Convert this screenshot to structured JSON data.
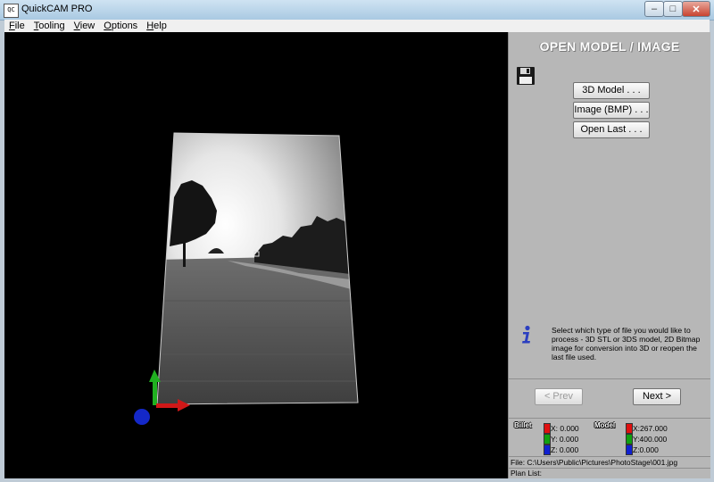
{
  "window": {
    "title": "QuickCAM PRO",
    "icon_text": "QC",
    "controls": {
      "minimize": "–",
      "maximize": "□",
      "close": "✕"
    }
  },
  "menu": {
    "items": [
      {
        "underlined": "F",
        "rest": "ile"
      },
      {
        "underlined": "T",
        "rest": "ooling"
      },
      {
        "underlined": "V",
        "rest": "iew"
      },
      {
        "underlined": "O",
        "rest": "ptions"
      },
      {
        "underlined": "H",
        "rest": "elp"
      }
    ]
  },
  "panel": {
    "title": "OPEN MODEL / IMAGE",
    "icon": "floppy-disk-icon",
    "buttons": {
      "model_3d": "3D Model . . .",
      "image_bmp": "Image (BMP) . . .",
      "open_last": "Open Last . . ."
    },
    "info_icon": "info-icon",
    "info_text": "Select which type of file you would like to process - 3D STL or 3DS model, 2D Bitmap image for conversion into 3D or reopen the last file used.",
    "prev_label": "< Prev",
    "next_label": "Next >"
  },
  "coords": {
    "billet_label": "Billet",
    "model_label": "Model",
    "billet": {
      "x": "X: 0.000",
      "y": "Y: 0.000",
      "z": "Z: 0.000"
    },
    "model": {
      "x": "X:267.000",
      "y": "Y:400.000",
      "z": "Z:0.000"
    },
    "colors": {
      "x": "#e01010",
      "y": "#10a010",
      "z": "#1020d0"
    }
  },
  "status": {
    "file": "File: C:\\Users\\Public\\Pictures\\PhotoStage\\001.jpg",
    "plan_list": "Plan List:"
  },
  "scene": {
    "image_subject": "grayscale landscape photo: trees, sky, grassy field and road",
    "axis_colors": {
      "x": "#e01010",
      "y": "#10a010",
      "z": "#1020d0"
    }
  }
}
